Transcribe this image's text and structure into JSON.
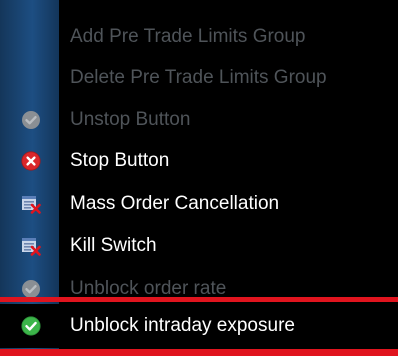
{
  "menu": {
    "items": [
      {
        "label": "Add Pre Trade Limits Group",
        "icon": "none",
        "state": "disabled"
      },
      {
        "label": "Delete Pre Trade Limits Group",
        "icon": "none",
        "state": "disabled"
      },
      {
        "label": "Unstop Button",
        "icon": "grey-check-circle-icon",
        "state": "disabled"
      },
      {
        "label": "Stop Button",
        "icon": "red-x-circle-icon",
        "state": "enabled"
      },
      {
        "label": "Mass Order Cancellation",
        "icon": "list-with-red-x-icon",
        "state": "enabled"
      },
      {
        "label": "Kill Switch",
        "icon": "list-with-red-x-icon",
        "state": "enabled"
      },
      {
        "label": "Unblock order rate",
        "icon": "grey-check-circle-icon",
        "state": "disabled"
      },
      {
        "label": "Unblock intraday exposure",
        "icon": "green-check-circle-icon",
        "state": "enabled"
      }
    ]
  },
  "colors": {
    "background": "#000000",
    "gutter": "#1d4e82",
    "disabled_text": "#4f5459",
    "enabled_text": "#ffffff",
    "highlight_border": "#e0141e",
    "stop_red": "#d9262b",
    "ok_green": "#3cb54a"
  }
}
